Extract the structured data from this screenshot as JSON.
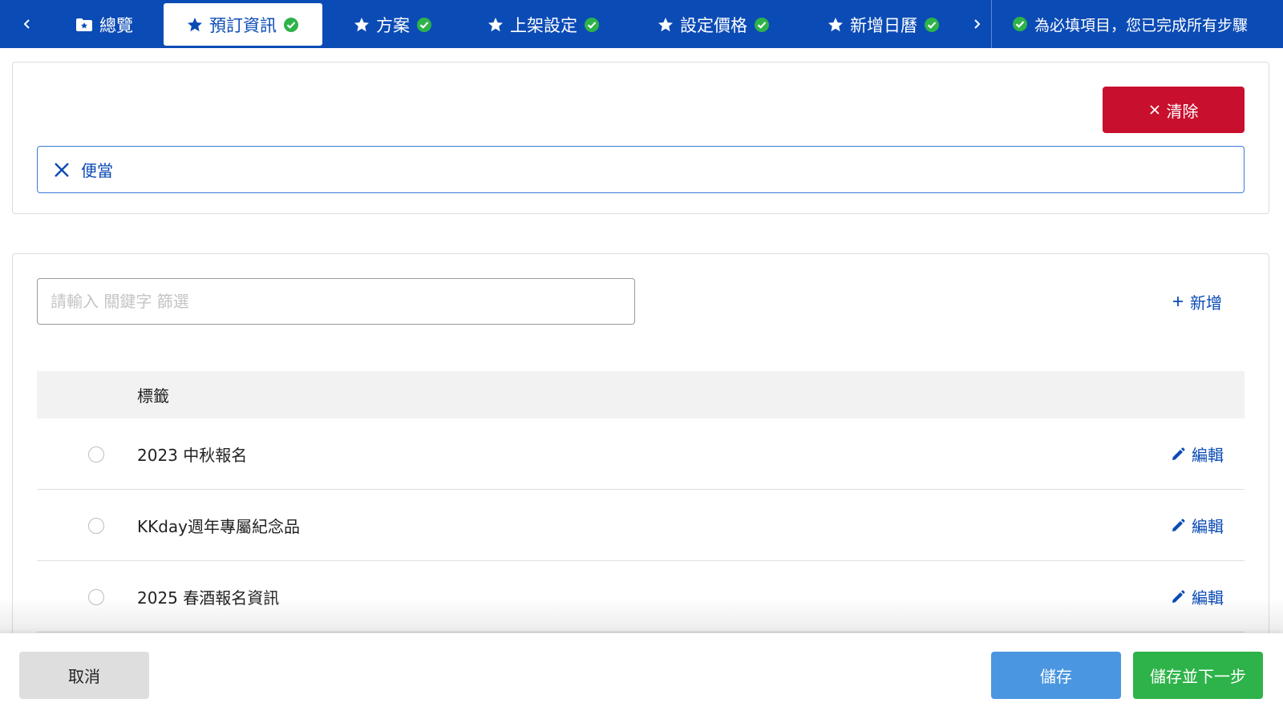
{
  "nav": {
    "prev_icon": "chevron-left-icon",
    "next_icon": "chevron-right-icon",
    "tabs": [
      {
        "label": "總覽",
        "icon": "folder-star-icon",
        "completed": false,
        "active": false
      },
      {
        "label": "預訂資訊",
        "icon": "star-icon",
        "completed": true,
        "active": true
      },
      {
        "label": "方案",
        "icon": "star-icon",
        "completed": true,
        "active": false
      },
      {
        "label": "上架設定",
        "icon": "star-icon",
        "completed": true,
        "active": false
      },
      {
        "label": "設定價格",
        "icon": "star-icon",
        "completed": true,
        "active": false
      },
      {
        "label": "新增日曆",
        "icon": "star-icon",
        "completed": true,
        "active": false
      }
    ],
    "status_text": "為必填項目，您已完成所有步驟"
  },
  "selected": {
    "clear_label": "清除",
    "tag": "便當"
  },
  "search": {
    "placeholder": "請輸入 關鍵字 篩選",
    "value": ""
  },
  "add_label": "新增",
  "table": {
    "header": "標籤",
    "edit_label": "編輯",
    "rows": [
      {
        "label": "2023 中秋報名"
      },
      {
        "label": "KKday週年專屬紀念品"
      },
      {
        "label": "2025 春酒報名資訊"
      }
    ]
  },
  "footer": {
    "cancel_label": "取消",
    "save_label": "儲存",
    "save_next_label": "儲存並下一步"
  },
  "colors": {
    "brand_blue": "#0b4bb5",
    "danger_red": "#c8102e",
    "success_green": "#2eb34a",
    "save_blue": "#4a96e0"
  }
}
